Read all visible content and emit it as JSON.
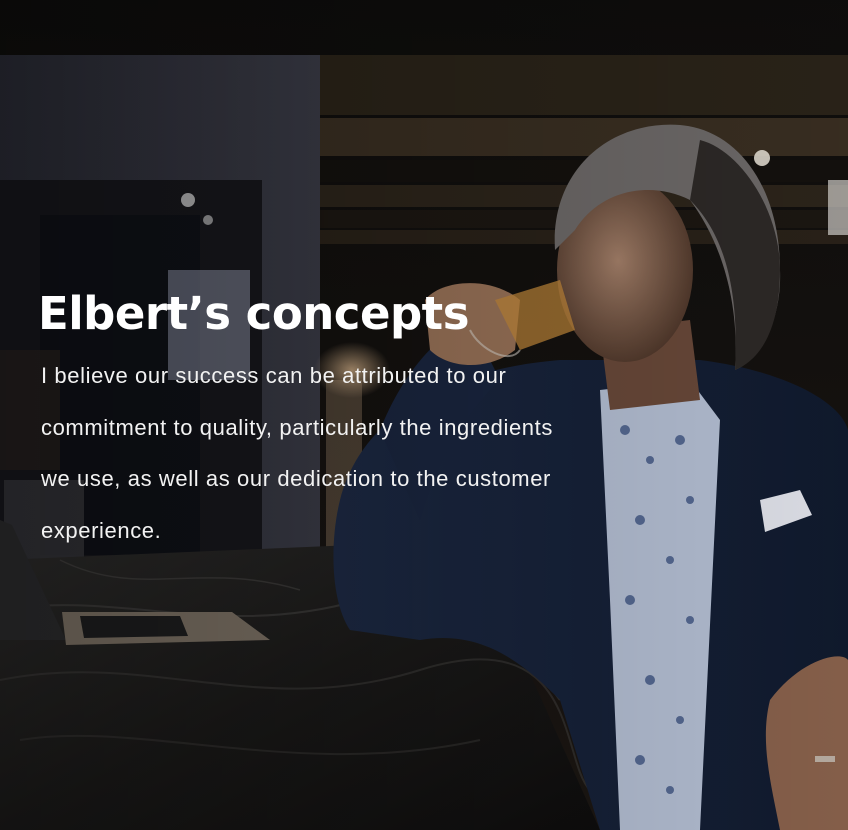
{
  "hero": {
    "title": "Elbert’s concepts",
    "text": "I believe our success can be attributed to our commitment to quality, particularly the ingredients we use, as well as our dedication to the customer experience."
  },
  "colors": {
    "title": "#ffffff",
    "text": "#f2f2f2",
    "jacket": "#16233c",
    "background": "#0c0b0a"
  }
}
